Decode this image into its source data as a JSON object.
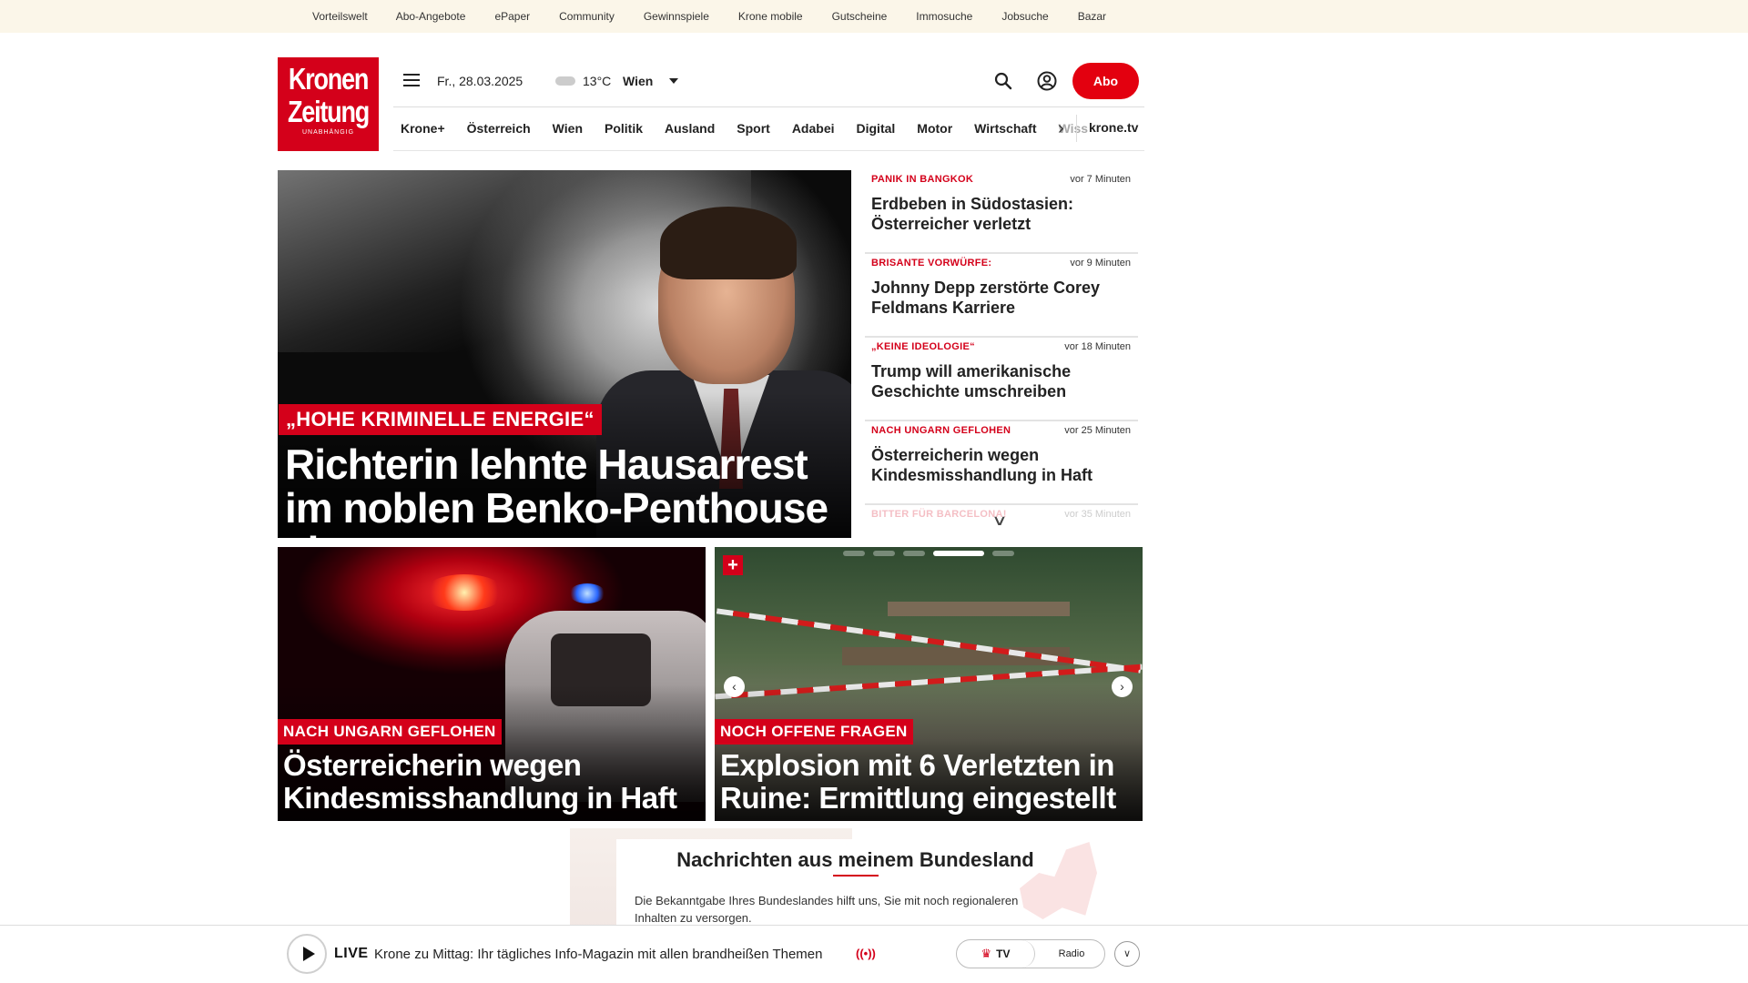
{
  "topbar": {
    "links": [
      "Vorteilswelt",
      "Abo-Angebote",
      "ePaper",
      "Community",
      "Gewinnspiele",
      "Krone mobile",
      "Gutscheine",
      "Immosuche",
      "Jobsuche",
      "Bazar"
    ]
  },
  "header": {
    "logo_line1": "Kronen",
    "logo_line2": "Zeitung",
    "logo_tagline": "UNABHÄNGIG",
    "date": "Fr., 28.03.2025",
    "temperature": "13°C",
    "city": "Wien",
    "abo_label": "Abo"
  },
  "nav": {
    "items": [
      "Krone+",
      "Österreich",
      "Wien",
      "Politik",
      "Ausland",
      "Sport",
      "Adabei",
      "Digital",
      "Motor",
      "Wirtschaft"
    ],
    "overflow_item": "Wiss",
    "tv_link": "krone.tv"
  },
  "hero": {
    "kicker": "„HOHE KRIMINELLE ENERGIE“",
    "title": "Richterin lehnte Hausarrest im noblen Benko-Penthouse ab"
  },
  "ticker": [
    {
      "kicker": "PANIK IN BANGKOK",
      "time": "vor 7 Minuten",
      "title": "Erdbeben in Südostasien: Österreicher verletzt"
    },
    {
      "kicker": "BRISANTE VORWÜRFE:",
      "time": "vor 9 Minuten",
      "title": "Johnny Depp zerstörte Corey Feldmans Karriere"
    },
    {
      "kicker": "„KEINE IDEOLOGIE“",
      "time": "vor 18 Minuten",
      "title": "Trump will amerikanische Geschichte umschreiben"
    },
    {
      "kicker": "NACH UNGARN GEFLOHEN",
      "time": "vor 25 Minuten",
      "title": "Österreicherin wegen Kindesmisshandlung in Haft"
    },
    {
      "kicker": "BITTER FÜR BARCELONA!",
      "time": "vor 35 Minuten",
      "title": ""
    }
  ],
  "cards": [
    {
      "kicker": "NACH UNGARN GEFLOHEN",
      "title": "Österreicherin wegen Kindesmisshandlung in Haft"
    },
    {
      "kicker": "NOCH OFFENE FRAGEN",
      "title": "Explosion mit 6 Verletzten in Ruine: Ermittlung eingestellt"
    }
  ],
  "carousel": {
    "slide_count": 5,
    "active_slide": 4
  },
  "bundesland": {
    "title": "Nachrichten aus meinem Bundesland",
    "text": "Die Bekanntgabe Ihres Bundeslandes hilft uns, Sie mit noch regionaleren Inhalten zu versorgen."
  },
  "livebar": {
    "live_label": "LIVE",
    "text": "Krone zu Mittag: Ihr tägliches Info-Magazin mit allen brandheißen Themen",
    "tv_label": "TV",
    "radio_label": "Radio"
  },
  "colors": {
    "brand_red": "#d4001a",
    "topbar_bg": "#fbf6e9"
  },
  "icons": [
    "hamburger-icon",
    "cloud-icon",
    "chevron-down-icon",
    "search-icon",
    "user-icon",
    "chevron-right-icon",
    "plus-icon",
    "arrow-left-icon",
    "arrow-right-icon",
    "play-icon",
    "broadcast-icon",
    "crown-icon"
  ]
}
